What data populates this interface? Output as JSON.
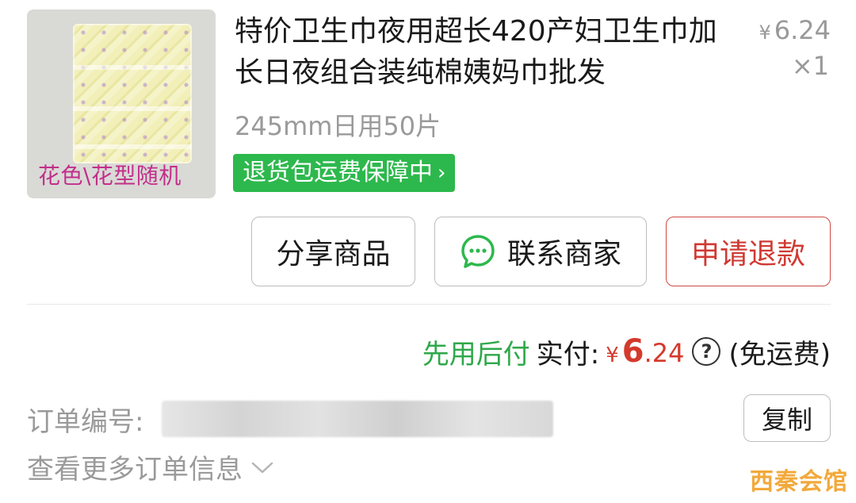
{
  "product": {
    "image_caption": "花色\\花型随机",
    "title": "特价卫生巾夜用超长420产妇卫生巾加长日夜组合装纯棉姨妈巾批发",
    "price_currency": "¥",
    "price_value": "6.24",
    "quantity": "×1",
    "sku": "245mm日用50片",
    "guarantee": "退货包运费保障中",
    "guarantee_chevron": "›"
  },
  "actions": {
    "share": "分享商品",
    "contact": "联系商家",
    "refund": "申请退款"
  },
  "payment": {
    "later_label": "先用后付",
    "paid_label": "实付:",
    "currency": "¥",
    "amount_int": "6",
    "amount_dec": ".24",
    "help": "?",
    "shipping_note": "(免运费)"
  },
  "order": {
    "number_label": "订单编号:",
    "copy_label": "复制",
    "more_info": "查看更多订单信息"
  },
  "watermark": "西秦会馆",
  "colors": {
    "guarantee_bg": "#2db84d",
    "refund": "#cf3a33",
    "price_red": "#d33a2c",
    "later_green": "#2fa84a"
  }
}
